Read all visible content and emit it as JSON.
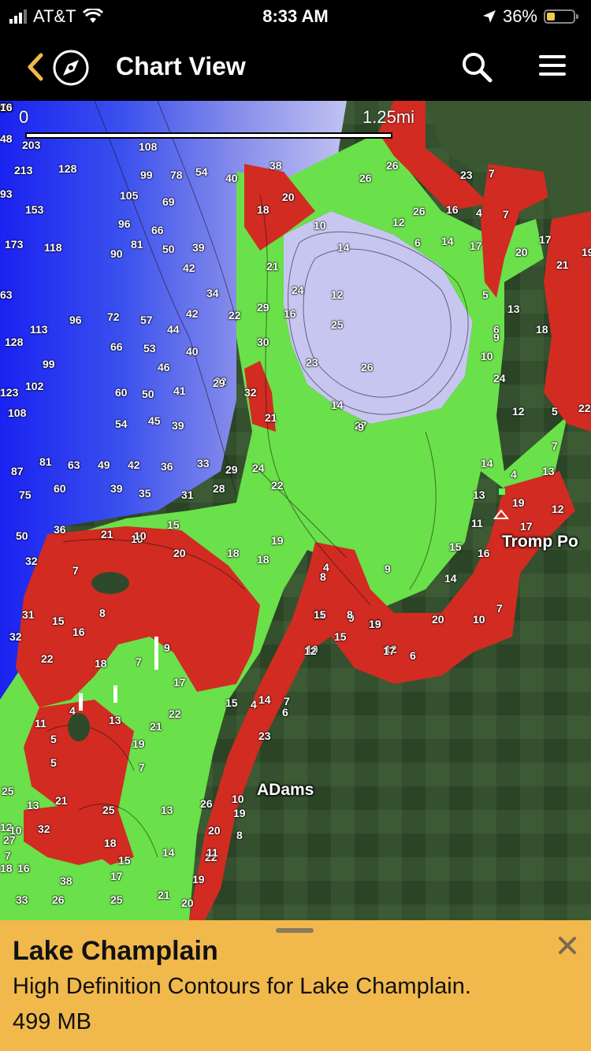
{
  "status": {
    "carrier": "AT&T",
    "time": "8:33 AM",
    "battery": "36%"
  },
  "nav": {
    "title": "Chart View"
  },
  "map": {
    "scale_start": "0",
    "scale_end": "1.25mi",
    "places": [
      "Tromp Po",
      "ADams"
    ],
    "colors": {
      "deep": "#2a3cf0",
      "mid": "#8a8fe8",
      "light": "#c8c8f0",
      "shallow_green": "#6ae04a",
      "very_shallow_red": "#d42a22",
      "land": "#2f4a2a"
    },
    "depths": [
      {
        "t": "48"
      },
      {
        "t": "203"
      },
      {
        "t": "108"
      },
      {
        "t": "213"
      },
      {
        "t": "128"
      },
      {
        "t": "99"
      },
      {
        "t": "78"
      },
      {
        "t": "54"
      },
      {
        "t": "40"
      },
      {
        "t": "93"
      },
      {
        "t": "105"
      },
      {
        "t": "69"
      },
      {
        "t": "153"
      },
      {
        "t": "96"
      },
      {
        "t": "66"
      },
      {
        "t": "173"
      },
      {
        "t": "118"
      },
      {
        "t": "90"
      },
      {
        "t": "81"
      },
      {
        "t": "50"
      },
      {
        "t": "39"
      },
      {
        "t": "42"
      },
      {
        "t": "63"
      },
      {
        "t": "34"
      },
      {
        "t": "113"
      },
      {
        "t": "96"
      },
      {
        "t": "72"
      },
      {
        "t": "57"
      },
      {
        "t": "44"
      },
      {
        "t": "42"
      },
      {
        "t": "128"
      },
      {
        "t": "66"
      },
      {
        "t": "53"
      },
      {
        "t": "40"
      },
      {
        "t": "99"
      },
      {
        "t": "46"
      },
      {
        "t": "123"
      },
      {
        "t": "102"
      },
      {
        "t": "60"
      },
      {
        "t": "50"
      },
      {
        "t": "41"
      },
      {
        "t": "32"
      },
      {
        "t": "108"
      },
      {
        "t": "54"
      },
      {
        "t": "45"
      },
      {
        "t": "39"
      },
      {
        "t": "87"
      },
      {
        "t": "81"
      },
      {
        "t": "63"
      },
      {
        "t": "49"
      },
      {
        "t": "42"
      },
      {
        "t": "36"
      },
      {
        "t": "33"
      },
      {
        "t": "29"
      },
      {
        "t": "24"
      },
      {
        "t": "75"
      },
      {
        "t": "60"
      },
      {
        "t": "39"
      },
      {
        "t": "35"
      },
      {
        "t": "31"
      },
      {
        "t": "28"
      },
      {
        "t": "22"
      },
      {
        "t": "36"
      },
      {
        "t": "50"
      },
      {
        "t": "21"
      },
      {
        "t": "10"
      },
      {
        "t": "15"
      },
      {
        "t": "32"
      },
      {
        "t": "7"
      },
      {
        "t": "18"
      },
      {
        "t": "18"
      },
      {
        "t": "19"
      },
      {
        "t": "10"
      },
      {
        "t": "20"
      },
      {
        "t": "31"
      },
      {
        "t": "15"
      },
      {
        "t": "8"
      },
      {
        "t": "8"
      },
      {
        "t": "32"
      },
      {
        "t": "16"
      },
      {
        "t": "9"
      },
      {
        "t": "22"
      },
      {
        "t": "18"
      },
      {
        "t": "7"
      },
      {
        "t": "11"
      },
      {
        "t": "9"
      },
      {
        "t": "15"
      },
      {
        "t": "12"
      },
      {
        "t": "10"
      },
      {
        "t": "17"
      },
      {
        "t": "4"
      },
      {
        "t": "13"
      },
      {
        "t": "5"
      },
      {
        "t": "21"
      },
      {
        "t": "22"
      },
      {
        "t": "15"
      },
      {
        "t": "14"
      },
      {
        "t": "6"
      },
      {
        "t": "11"
      },
      {
        "t": "5"
      },
      {
        "t": "19"
      },
      {
        "t": "25"
      },
      {
        "t": "13"
      },
      {
        "t": "7"
      },
      {
        "t": "23"
      },
      {
        "t": "21"
      },
      {
        "t": "12"
      },
      {
        "t": "25"
      },
      {
        "t": "13"
      },
      {
        "t": "26"
      },
      {
        "t": "19"
      },
      {
        "t": "10"
      },
      {
        "t": "32"
      },
      {
        "t": "20"
      },
      {
        "t": "18"
      },
      {
        "t": "14"
      },
      {
        "t": "27"
      },
      {
        "t": "7"
      },
      {
        "t": "15"
      },
      {
        "t": "22"
      },
      {
        "t": "16"
      },
      {
        "t": "38"
      },
      {
        "t": "18"
      },
      {
        "t": "19"
      },
      {
        "t": "17"
      },
      {
        "t": "33"
      },
      {
        "t": "26"
      },
      {
        "t": "25"
      },
      {
        "t": "21"
      },
      {
        "t": "20"
      },
      {
        "t": "38"
      },
      {
        "t": "20"
      },
      {
        "t": "18"
      },
      {
        "t": "10"
      },
      {
        "t": "21"
      },
      {
        "t": "14"
      },
      {
        "t": "24"
      },
      {
        "t": "29"
      },
      {
        "t": "16"
      },
      {
        "t": "25"
      },
      {
        "t": "22"
      },
      {
        "t": "26"
      },
      {
        "t": "12"
      },
      {
        "t": "30"
      },
      {
        "t": "23"
      },
      {
        "t": "29"
      },
      {
        "t": "32"
      },
      {
        "t": "14"
      },
      {
        "t": "21"
      },
      {
        "t": "27"
      },
      {
        "t": "9"
      },
      {
        "t": "26"
      },
      {
        "t": "26"
      },
      {
        "t": "23"
      },
      {
        "t": "7"
      },
      {
        "t": "26"
      },
      {
        "t": "16"
      },
      {
        "t": "4"
      },
      {
        "t": "7"
      },
      {
        "t": "12"
      },
      {
        "t": "6"
      },
      {
        "t": "14"
      },
      {
        "t": "17"
      },
      {
        "t": "17"
      },
      {
        "t": "20"
      },
      {
        "t": "19"
      },
      {
        "t": "21"
      },
      {
        "t": "5"
      },
      {
        "t": "13"
      },
      {
        "t": "6"
      },
      {
        "t": "9"
      },
      {
        "t": "18"
      },
      {
        "t": "10"
      },
      {
        "t": "24"
      },
      {
        "t": "12"
      },
      {
        "t": "5"
      },
      {
        "t": "22"
      },
      {
        "t": "7"
      },
      {
        "t": "14"
      },
      {
        "t": "4"
      },
      {
        "t": "13"
      },
      {
        "t": "13"
      },
      {
        "t": "19"
      },
      {
        "t": "12"
      },
      {
        "t": "11"
      },
      {
        "t": "17"
      },
      {
        "t": "16"
      },
      {
        "t": "15"
      },
      {
        "t": "9"
      },
      {
        "t": "14"
      },
      {
        "t": "7"
      },
      {
        "t": "10"
      },
      {
        "t": "19"
      },
      {
        "t": "20"
      },
      {
        "t": "17"
      },
      {
        "t": "6"
      },
      {
        "t": "4"
      },
      {
        "t": "15"
      },
      {
        "t": "15"
      },
      {
        "t": "12"
      },
      {
        "t": "7"
      },
      {
        "t": "8"
      },
      {
        "t": "4"
      },
      {
        "t": "10"
      },
      {
        "t": "8"
      },
      {
        "t": "11"
      },
      {
        "t": "9"
      },
      {
        "t": "14"
      },
      {
        "t": "13"
      },
      {
        "t": "10"
      },
      {
        "t": "7"
      },
      {
        "t": "16"
      }
    ]
  },
  "sheet": {
    "title": "Lake Champlain",
    "description": "High Definition Contours for Lake Champlain.",
    "size": "499 MB"
  }
}
